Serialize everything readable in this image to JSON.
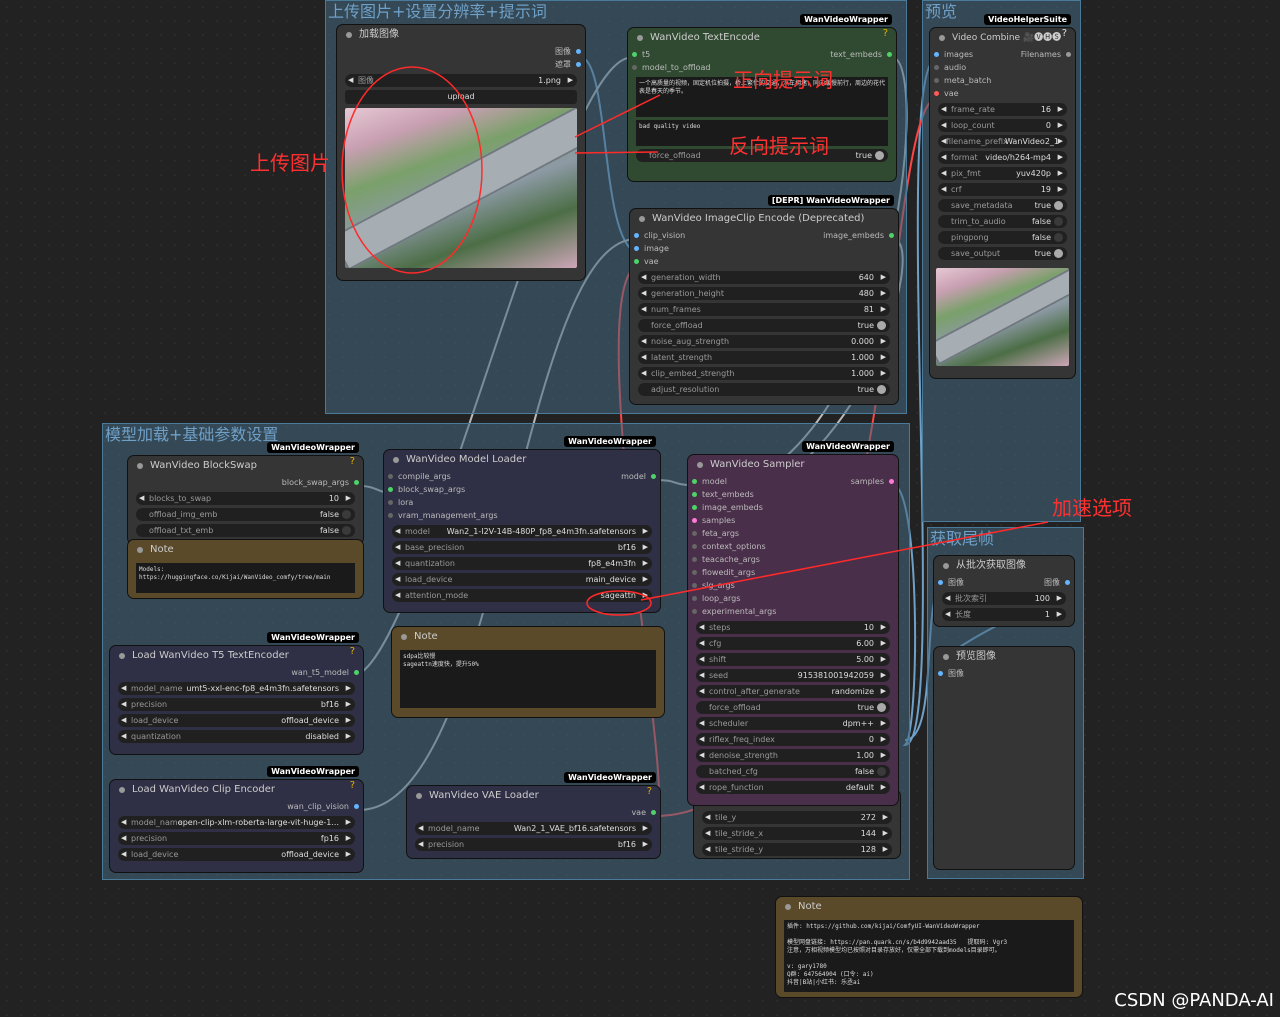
{
  "groups": {
    "upload": "上传图片+设置分辨率+提示词",
    "preview": "预览",
    "model": "模型加载+基础参数设置",
    "tail": "获取尾帧"
  },
  "annotations": {
    "upload_image": "上传图片",
    "positive": "正向提示词",
    "negative": "反向提示词",
    "accel": "加速选项"
  },
  "load_image": {
    "title": "加载图像",
    "out_image": "图像",
    "out_mask": "遮罩",
    "image_label": "图像",
    "image_value": "1.png",
    "upload": "upload"
  },
  "text_encode": {
    "badge": "WanVideoWrapper",
    "title": "WanVideo TextEncode",
    "q": "?",
    "in_t5": "t5",
    "in_offload": "model_to_offload",
    "out": "text_embeds",
    "positive_text": "一个高质量的视频，固定机位拍摄，桥上繁忙的交通，汽车拥堵，同向缓慢前行，周边的花代表是春天的季节。",
    "negative_text": "bad quality video",
    "force_offload": "force_offload",
    "force_offload_v": "true"
  },
  "clip_encode": {
    "badge": "[DEPR] WanVideoWrapper",
    "title": "WanVideo ImageClip Encode (Deprecated)",
    "in_clip": "clip_vision",
    "in_image": "image",
    "in_vae": "vae",
    "out": "image_embeds",
    "widgets": [
      [
        "generation_width",
        "640"
      ],
      [
        "generation_height",
        "480"
      ],
      [
        "num_frames",
        "81"
      ]
    ],
    "force_offload": "force_offload",
    "force_offload_v": "true",
    "widgets2": [
      [
        "noise_aug_strength",
        "0.000"
      ],
      [
        "latent_strength",
        "1.000"
      ],
      [
        "clip_embed_strength",
        "1.000"
      ]
    ],
    "adjust": "adjust_resolution",
    "adjust_v": "true"
  },
  "video_combine": {
    "badge": "VideoHelperSuite",
    "title": "Video Combine 🎥🅥🅗🅢",
    "q": "?",
    "in_images": "images",
    "in_audio": "audio",
    "in_meta": "meta_batch",
    "in_vae": "vae",
    "out": "Filenames",
    "widgets": [
      [
        "frame_rate",
        "16"
      ],
      [
        "loop_count",
        "0"
      ],
      [
        "filename_prefix",
        "WanVideo2_1"
      ],
      [
        "format",
        "video/h264-mp4"
      ],
      [
        "pix_fmt",
        "yuv420p"
      ],
      [
        "crf",
        "19"
      ]
    ],
    "toggles": [
      [
        "save_metadata",
        "true"
      ],
      [
        "trim_to_audio",
        "false"
      ],
      [
        "pingpong",
        "false"
      ],
      [
        "save_output",
        "true"
      ]
    ]
  },
  "blockswap": {
    "badge": "WanVideoWrapper",
    "title": "WanVideo BlockSwap",
    "q": "?",
    "out": "block_swap_args",
    "blocks_to_swap": "blocks_to_swap",
    "blocks_to_swap_v": "10",
    "offload_img_emb": "offload_img_emb",
    "offload_img_emb_v": "false",
    "offload_txt_emb": "offload_txt_emb",
    "offload_txt_emb_v": "false"
  },
  "note1": {
    "title": "Note",
    "text": "Models:\nhttps://huggingface.co/Kijai/WanVideo_comfy/tree/main"
  },
  "model_loader": {
    "badge": "WanVideoWrapper",
    "title": "WanVideo Model Loader",
    "in": [
      "compile_args",
      "block_swap_args",
      "lora",
      "vram_management_args"
    ],
    "out": "model",
    "widgets": [
      [
        "model",
        "Wan2_1-I2V-14B-480P_fp8_e4m3fn.safetensors"
      ],
      [
        "base_precision",
        "bf16"
      ],
      [
        "quantization",
        "fp8_e4m3fn"
      ],
      [
        "load_device",
        "main_device"
      ],
      [
        "attention_mode",
        "sageattn"
      ]
    ]
  },
  "note2": {
    "title": "Note",
    "text": "sdpa比较慢\nsageattn速度快，提升50%"
  },
  "t5": {
    "badge": "WanVideoWrapper",
    "title": "Load WanVideo T5 TextEncoder",
    "q": "?",
    "out": "wan_t5_model",
    "widgets": [
      [
        "model_name",
        "umt5-xxl-enc-fp8_e4m3fn.safetensors"
      ],
      [
        "precision",
        "bf16"
      ],
      [
        "load_device",
        "offload_device"
      ],
      [
        "quantization",
        "disabled"
      ]
    ]
  },
  "clip_loader": {
    "badge": "WanVideoWrapper",
    "title": "Load WanVideo Clip Encoder",
    "q": "?",
    "out": "wan_clip_vision",
    "widgets": [
      [
        "model_name",
        "open-clip-xlm-roberta-large-vit-huge-1..."
      ],
      [
        "precision",
        "fp16"
      ],
      [
        "load_device",
        "offload_device"
      ]
    ]
  },
  "vae_loader": {
    "badge": "WanVideoWrapper",
    "title": "WanVideo VAE Loader",
    "q": "?",
    "out": "vae",
    "widgets": [
      [
        "model_name",
        "Wan2_1_VAE_bf16.safetensors"
      ],
      [
        "precision",
        "bf16"
      ]
    ]
  },
  "sampler": {
    "badge": "WanVideoWrapper",
    "title": "WanVideo Sampler",
    "out": "samples",
    "in": [
      "model",
      "text_embeds",
      "image_embeds",
      "samples",
      "feta_args",
      "context_options",
      "teacache_args",
      "flowedit_args",
      "slg_args",
      "loop_args",
      "experimental_args"
    ],
    "widgets": [
      [
        "steps",
        "10"
      ],
      [
        "cfg",
        "6.00"
      ],
      [
        "shift",
        "5.00"
      ],
      [
        "seed",
        "915381001942059"
      ],
      [
        "control_after_generate",
        "randomize"
      ]
    ],
    "force_offload": "force_offload",
    "force_offload_v": "true",
    "widgets2": [
      [
        "scheduler",
        "dpm++"
      ],
      [
        "riflex_freq_index",
        "0"
      ],
      [
        "denoise_strength",
        "1.00"
      ]
    ],
    "batched": "batched_cfg",
    "batched_v": "false",
    "rope": "rope_function",
    "rope_v": "default"
  },
  "tile": {
    "widgets": [
      [
        "tile_y",
        "272"
      ],
      [
        "tile_stride_x",
        "144"
      ],
      [
        "tile_stride_y",
        "128"
      ]
    ]
  },
  "batch_get": {
    "title": "从批次获取图像",
    "in": "图像",
    "out": "图像",
    "widgets": [
      [
        "批次索引",
        "100"
      ],
      [
        "长度",
        "1"
      ]
    ]
  },
  "preview_img": {
    "title": "预览图像",
    "in": "图像"
  },
  "note3": {
    "title": "Note",
    "text": "插件: https://github.com/kijai/ComfyUI-WanVideoWrapper\n\n模型网盘链接: https://pan.quark.cn/s/b4d9942aad35   提取码: Vgr3\n注意，万相视频模型均已按照对目录存放好，仅需全部下载到models目录即可。\n\nv: gary1780\nQ群: 647564904 (口令: ai)\n抖音|B站|小红书: 乐丞ai"
  },
  "watermark": "CSDN @PANDA-AI"
}
